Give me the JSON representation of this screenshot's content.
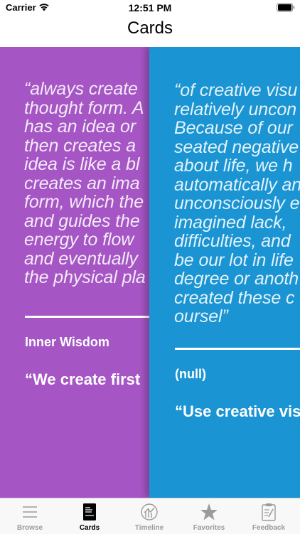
{
  "status_bar": {
    "carrier": "Carrier",
    "time": "12:51 PM"
  },
  "nav": {
    "title": "Cards"
  },
  "cards": [
    {
      "color": "#a555c4",
      "quote_lines": [
        "“always create",
        "thought form. A",
        "has an idea or",
        "then creates a",
        "idea is like a bl",
        "creates an ima",
        "form, which the",
        "and guides the",
        "energy to flow",
        "and eventually",
        "the physical pla"
      ],
      "title": "Inner Wisdom",
      "subtitle": "“We create first"
    },
    {
      "color": "#1a94d2",
      "quote_lines": [
        "“of creative visu",
        "relatively uncon",
        "Because of our",
        "seated negative",
        "about life, we h",
        "automatically an",
        "unconsciously e",
        "imagined lack,",
        "difficulties, and",
        "be our lot in life",
        "degree or anoth",
        "created these c",
        "oursel”"
      ],
      "title": "(null)",
      "subtitle": "“Use creative vis"
    }
  ],
  "page_indicator": {
    "current": 1,
    "total": 2
  },
  "tab_bar": {
    "tabs": [
      {
        "label": "Browse",
        "icon": "menu-lines-icon",
        "selected": false
      },
      {
        "label": "Cards",
        "icon": "card-icon",
        "selected": true
      },
      {
        "label": "Timeline",
        "icon": "timeline-chart-icon",
        "selected": false
      },
      {
        "label": "Favorites",
        "icon": "star-icon",
        "selected": false
      },
      {
        "label": "Feedback",
        "icon": "clipboard-icon",
        "selected": false
      }
    ],
    "selected_color": "#000000",
    "unselected_color": "#9b9b9b"
  }
}
